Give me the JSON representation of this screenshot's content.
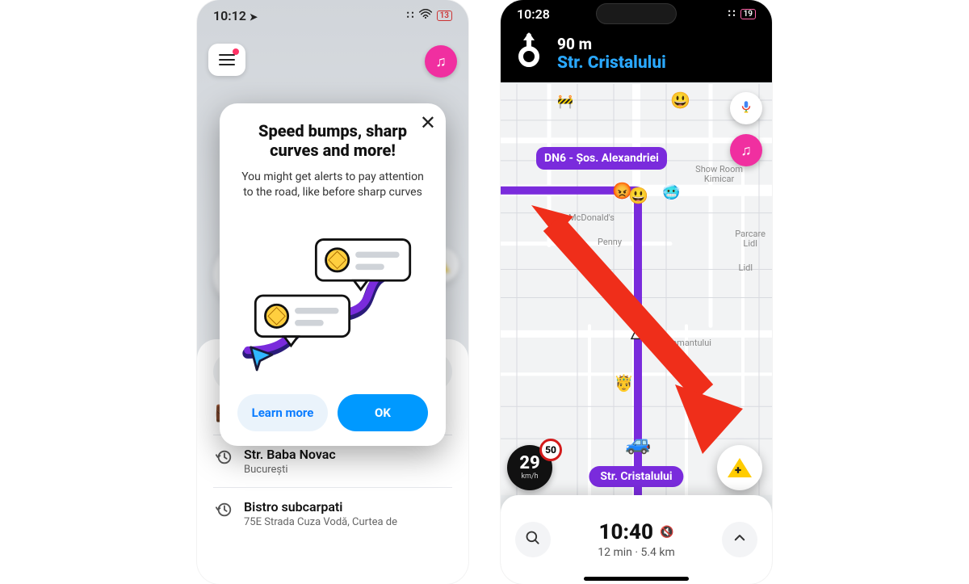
{
  "left": {
    "status": {
      "time": "10:12",
      "battery": "13"
    },
    "dialog": {
      "title": "Speed bumps, sharp curves and more!",
      "body": "You might get alerts to pay attention to the road, like before sharp curves",
      "learn": "Learn more",
      "ok": "OK"
    },
    "list": {
      "items": [
        {
          "title": "Str. Baba Novac",
          "sub": "București"
        },
        {
          "title": "Bistro subcarpati",
          "sub": "75E Strada Cuza Vodă, Curtea de"
        }
      ]
    }
  },
  "right": {
    "status": {
      "time": "10:28",
      "battery": "19"
    },
    "nav": {
      "distance": "90 m",
      "street": "Str. Cristalului"
    },
    "route_label": "DN6 - Șos. Alexandriei",
    "route_pill": "Str. Cristalului",
    "speed": {
      "value": "29",
      "unit": "km/h",
      "limit": "50"
    },
    "poi": {
      "showroom": "Show Room\nKimicar",
      "mcd": "McDonald's",
      "penny": "Penny",
      "park": "Parcare\nLidl",
      "lidl": "Lidl",
      "diam": "tr. Diamantului"
    },
    "bottom": {
      "eta": "10:40",
      "duration": "12 min",
      "distance": "5.4 km"
    }
  }
}
